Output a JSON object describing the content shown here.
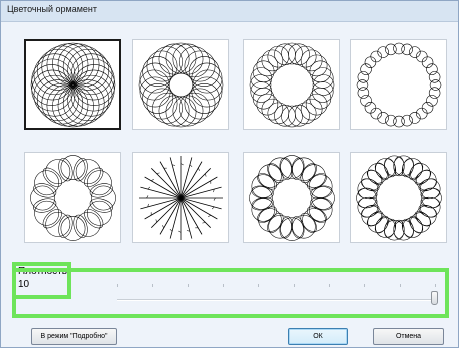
{
  "window": {
    "title": "Цветочный ормамент"
  },
  "patterns": [
    {
      "id": "pattern-1",
      "inner_radius": 0.02,
      "loops": 24,
      "kind": "loops",
      "selected": true
    },
    {
      "id": "pattern-2",
      "inner_radius": 0.28,
      "loops": 24,
      "kind": "loops",
      "selected": false
    },
    {
      "id": "pattern-3",
      "inner_radius": 0.5,
      "loops": 28,
      "kind": "loops",
      "selected": false
    },
    {
      "id": "pattern-4",
      "inner_radius": 0.74,
      "loops": 28,
      "kind": "loops",
      "selected": false
    },
    {
      "id": "pattern-5",
      "inner_radius": 0.45,
      "loops": 12,
      "kind": "petals",
      "selected": false
    },
    {
      "id": "pattern-6",
      "inner_radius": 0.0,
      "loops": 24,
      "kind": "rays",
      "selected": false
    },
    {
      "id": "pattern-7",
      "inner_radius": 0.48,
      "loops": 16,
      "kind": "petals",
      "selected": false
    },
    {
      "id": "pattern-8",
      "inner_radius": 0.55,
      "loops": 22,
      "kind": "petals",
      "selected": false
    }
  ],
  "density": {
    "label": "Плотность",
    "value": "10",
    "min": 1,
    "max": 10,
    "current": 10,
    "ticks": 10
  },
  "buttons": {
    "detailed_mode": "В режим \"Подробно\"",
    "ok": "ОК",
    "cancel": "Отмена"
  },
  "colors": {
    "highlight": "#6ee45a",
    "line": "#000000"
  }
}
